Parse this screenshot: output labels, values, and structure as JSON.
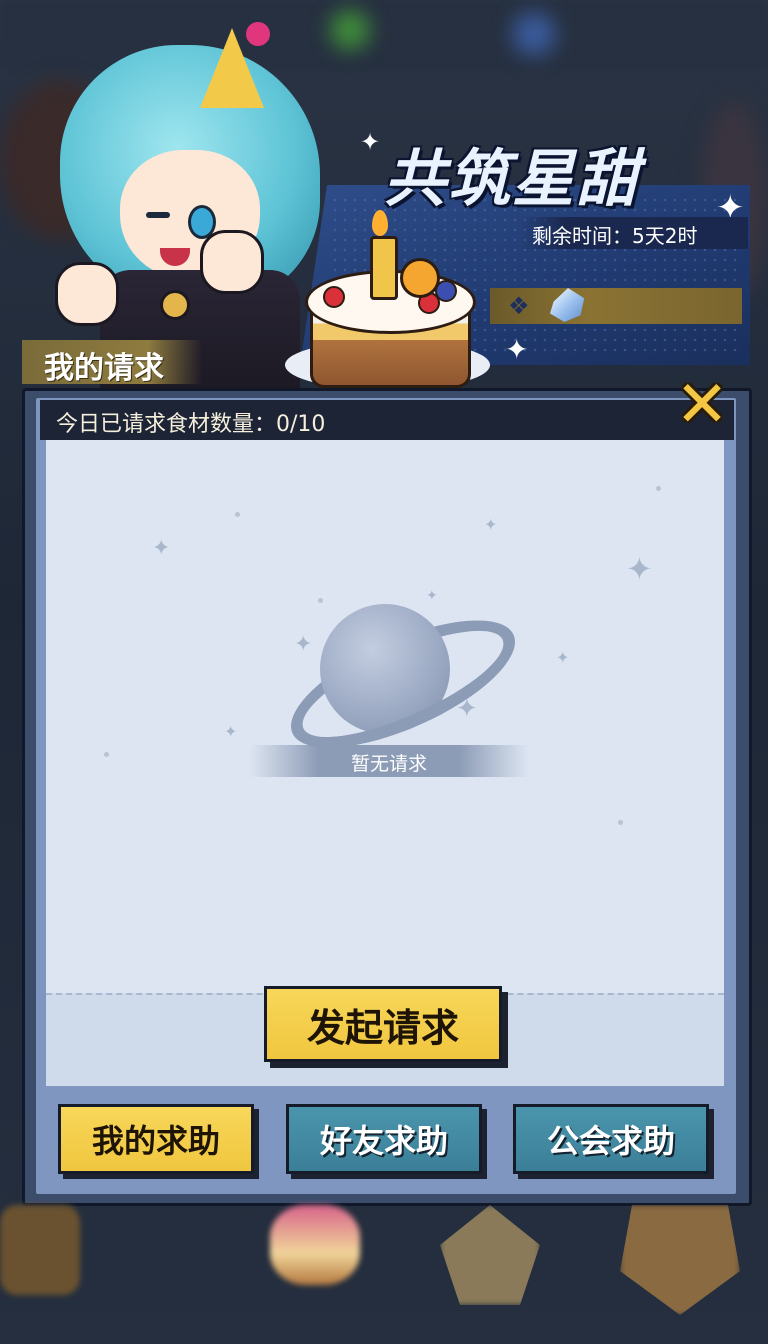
{
  "event": {
    "title": "共筑星甜",
    "remaining_time": "剩余时间：5天2时"
  },
  "panel": {
    "tab_title": "我的请求",
    "daily_count": "今日已请求食材数量：0/10",
    "empty_message": "暂无请求",
    "start_button": "发起请求"
  },
  "tabs": [
    {
      "label": "我的求助",
      "active": true
    },
    {
      "label": "好友求助",
      "active": false
    },
    {
      "label": "公会求助",
      "active": false
    }
  ],
  "colors": {
    "gold_button": "#f3c644",
    "teal_button": "#4a95ad",
    "panel_bg": "#dce5f1",
    "banner_blue": "#2f4d8a"
  },
  "icons": [
    "close-icon",
    "planet-icon",
    "sparkle-icon",
    "cake-icon",
    "diamond-icon"
  ]
}
